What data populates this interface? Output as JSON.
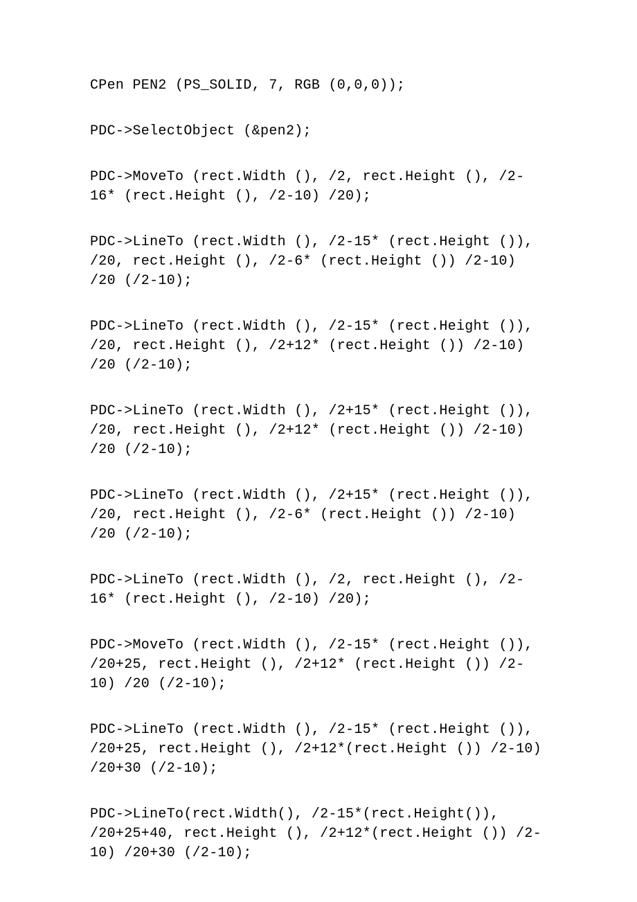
{
  "lines": [
    "CPen PEN2 (PS_SOLID, 7, RGB (0,0,0));",
    "PDC->SelectObject (&pen2);",
    "PDC->MoveTo (rect.Width (), /2, rect.Height (), /2-16* (rect.Height (), /2-10) /20);",
    "PDC->LineTo (rect.Width (), /2-15* (rect.Height ()), /20, rect.Height (), /2-6* (rect.Height ()) /2-10) /20 (/2-10);",
    "PDC->LineTo (rect.Width (), /2-15* (rect.Height ()), /20, rect.Height (), /2+12* (rect.Height ()) /2-10) /20 (/2-10);",
    "PDC->LineTo (rect.Width (), /2+15* (rect.Height ()), /20, rect.Height (), /2+12* (rect.Height ()) /2-10) /20 (/2-10);",
    "PDC->LineTo (rect.Width (), /2+15* (rect.Height ()), /20, rect.Height (), /2-6* (rect.Height ()) /2-10) /20 (/2-10);",
    "PDC->LineTo (rect.Width (), /2, rect.Height (), /2-16* (rect.Height (), /2-10) /20);",
    "PDC->MoveTo (rect.Width (), /2-15* (rect.Height ()), /20+25, rect.Height (), /2+12* (rect.Height ()) /2-10) /20 (/2-10);",
    "PDC->LineTo (rect.Width (), /2-15* (rect.Height ()), /20+25, rect.Height (), /2+12*(rect.Height ()) /2-10) /20+30 (/2-10);",
    "PDC->LineTo(rect.Width(), /2-15*(rect.Height()), /20+25+40, rect.Height (), /2+12*(rect.Height ()) /2-10) /20+30 (/2-10);"
  ]
}
